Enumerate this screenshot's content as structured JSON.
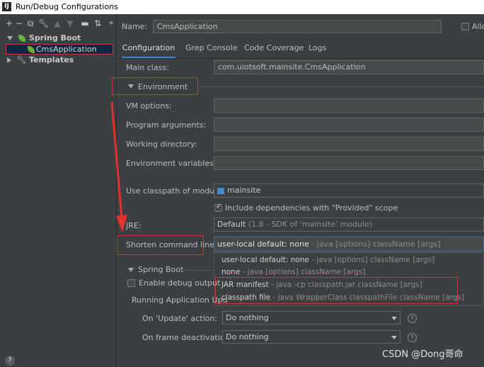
{
  "window": {
    "title": "Run/Debug Configurations",
    "app_icon": "IJ"
  },
  "left": {
    "toolbar": [
      "add-icon",
      "remove-icon",
      "copy-icon",
      "wrench-icon",
      "move-up-icon",
      "move-down-icon",
      "folder-icon",
      "sort-icon"
    ],
    "tree": {
      "spring_boot": "Spring Boot",
      "cms_application": "CmsApplication",
      "templates": "Templates"
    },
    "help": "?"
  },
  "header": {
    "name_label": "Name:",
    "name_value": "CmsApplication",
    "allow_label": "Allo"
  },
  "tabs": [
    "Configuration",
    "Grep Console",
    "Code Coverage",
    "Logs"
  ],
  "form": {
    "main_class_label": "Main class:",
    "main_class_value": "com.uiotsoft.mainsite.CmsApplication",
    "environment_label": "Environment",
    "vm_options_label": "VM options:",
    "program_args_label": "Program arguments:",
    "working_dir_label": "Working directory:",
    "env_vars_label": "Environment variables:",
    "classpath_label": "Use classpath of module:",
    "classpath_value": "mainsite",
    "include_deps_label": "Include dependencies with \"Provided\" scope",
    "jre_label": "JRE:",
    "jre_value": "Default",
    "jre_detail": "(1.8 - SDK of 'mainsite' module)",
    "shorten_label": "Shorten command line:",
    "shorten_value": "user-local default: none",
    "shorten_detail": "- java [options] className [args]",
    "spring_boot_label": "Spring Boot",
    "enable_debug_label": "Enable debug output",
    "running_app_label": "Running Application Upd",
    "on_update_label": "On 'Update' action:",
    "on_update_value": "Do nothing",
    "on_frame_label": "On frame deactivation:",
    "on_frame_value": "Do nothing"
  },
  "popup": [
    {
      "label": "user-local default: none",
      "detail": "- java [options] className [args]"
    },
    {
      "label": "none",
      "detail": "- java [options] className [args]"
    },
    {
      "label": "JAR manifest",
      "detail": "- java -cp classpath.jar className [args]"
    },
    {
      "label": "classpath file",
      "detail": "- java WrapperClass classpathFile className [args]"
    }
  ],
  "watermark": "CSDN @Dong哥命",
  "colors": {
    "background": "#3c3f41",
    "field": "#45494a",
    "selection": "#0d293e",
    "annotation_red": "#e03131",
    "tab_accent": "#4a88c7"
  }
}
